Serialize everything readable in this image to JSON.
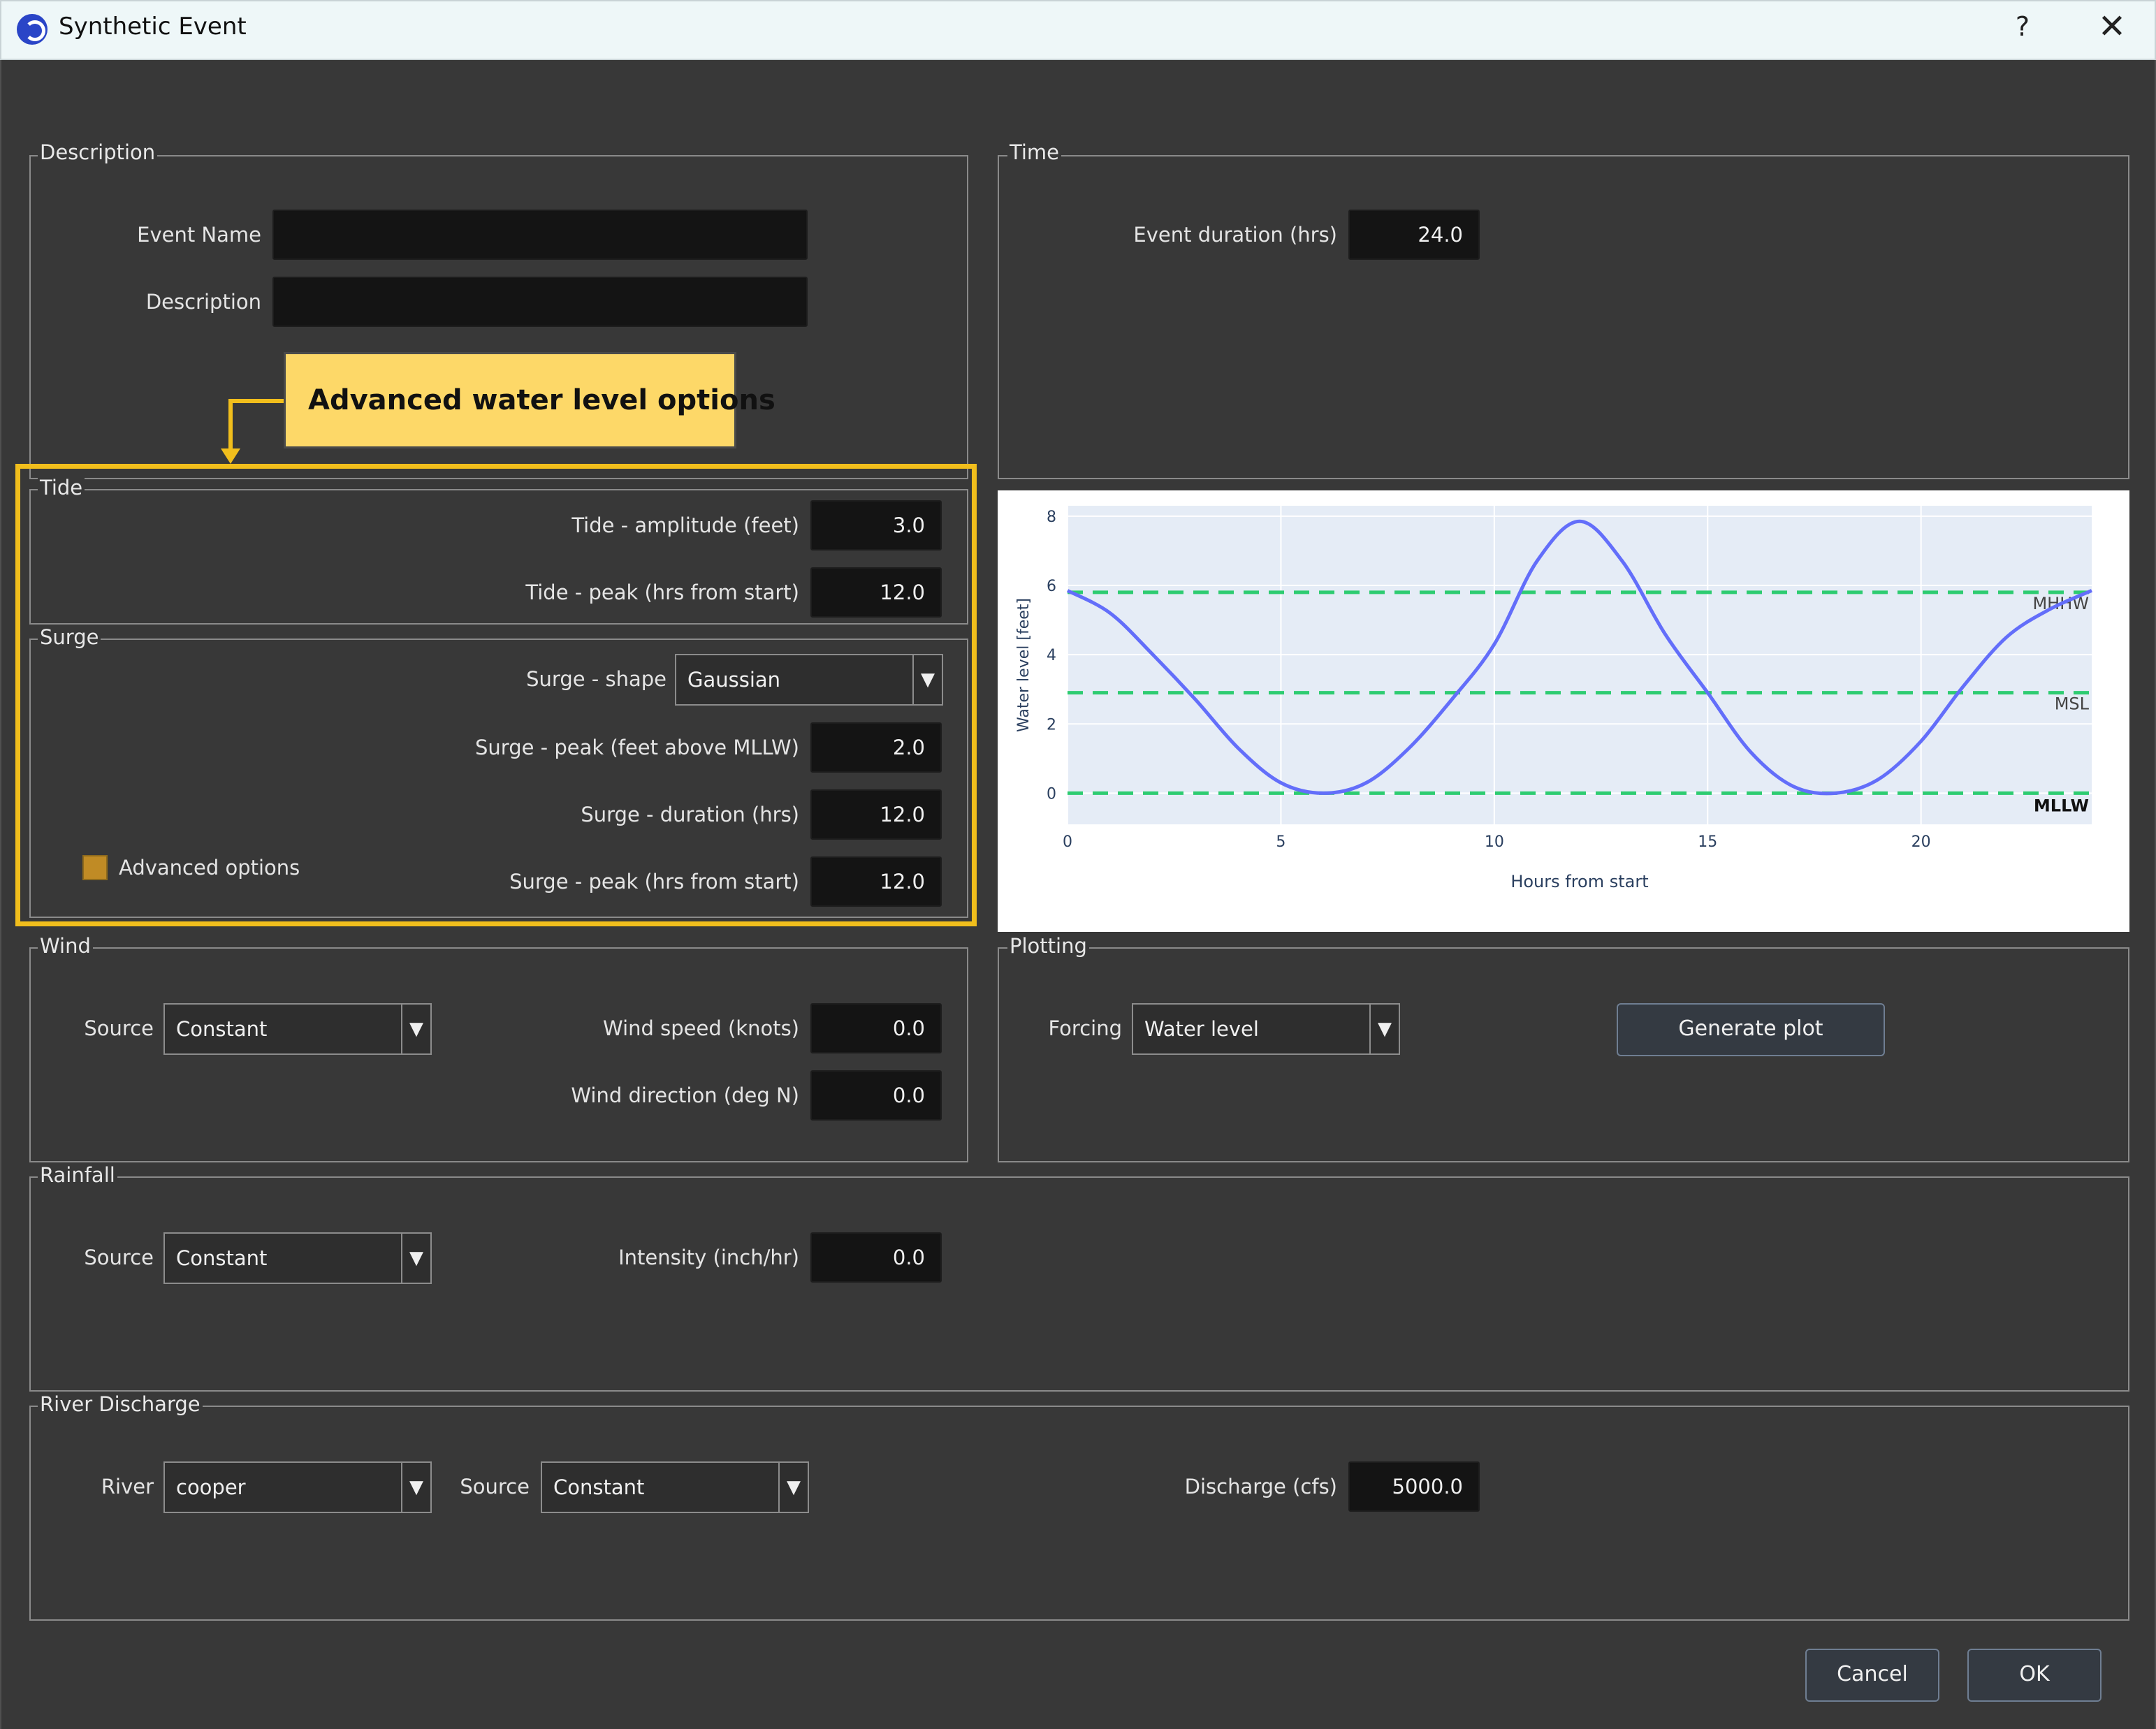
{
  "window": {
    "title": "Synthetic Event",
    "help_label": "?",
    "close_label": "✕",
    "app_icon": "app-logo-icon"
  },
  "callout": {
    "text": "Advanced water level options",
    "color": "#f1be1c"
  },
  "description_group": {
    "legend": "Description",
    "event_name_label": "Event Name",
    "event_name_value": "",
    "description_label": "Description",
    "description_value": ""
  },
  "time_group": {
    "legend": "Time",
    "duration_label": "Event duration (hrs)",
    "duration_value": "24.0"
  },
  "tide_group": {
    "legend": "Tide",
    "amplitude_label": "Tide - amplitude (feet)",
    "amplitude_value": "3.0",
    "peak_label": "Tide - peak (hrs from start)",
    "peak_value": "12.0"
  },
  "surge_group": {
    "legend": "Surge",
    "shape_label": "Surge - shape",
    "shape_value": "Gaussian",
    "peak_label": "Surge - peak (feet above MLLW)",
    "peak_value": "2.0",
    "duration_label": "Surge - duration (hrs)",
    "duration_value": "12.0",
    "peak_time_label": "Surge - peak (hrs from start)",
    "peak_time_value": "12.0",
    "advanced_label": "Advanced options",
    "advanced_checked": true
  },
  "wind_group": {
    "legend": "Wind",
    "source_label": "Source",
    "source_value": "Constant",
    "speed_label": "Wind speed (knots)",
    "speed_value": "0.0",
    "direction_label": "Wind direction (deg N)",
    "direction_value": "0.0"
  },
  "plotting_group": {
    "legend": "Plotting",
    "forcing_label": "Forcing",
    "forcing_value": "Water level",
    "generate_label": "Generate plot"
  },
  "rainfall_group": {
    "legend": "Rainfall",
    "source_label": "Source",
    "source_value": "Constant",
    "intensity_label": "Intensity (inch/hr)",
    "intensity_value": "0.0"
  },
  "river_group": {
    "legend": "River Discharge",
    "river_label": "River",
    "river_value": "cooper",
    "source_label": "Source",
    "source_value": "Constant",
    "discharge_label": "Discharge (cfs)",
    "discharge_value": "5000.0"
  },
  "buttons": {
    "cancel_label": "Cancel",
    "ok_label": "OK"
  },
  "chart_data": {
    "type": "line",
    "xlabel": "Hours from start",
    "ylabel": "Water level [feet]",
    "xlim": [
      0,
      24
    ],
    "ylim": [
      -0.9,
      8.3
    ],
    "x_ticks": [
      0,
      5,
      10,
      15,
      20
    ],
    "y_ticks": [
      0,
      2,
      4,
      6,
      8
    ],
    "grid": true,
    "series": [
      {
        "color": "#636efa",
        "x": [
          0,
          1,
          2,
          3,
          4,
          5,
          6,
          7,
          8,
          9,
          10,
          11,
          12,
          13,
          14,
          15,
          16,
          17,
          18,
          19,
          20,
          21,
          22,
          23,
          24
        ],
        "y": [
          5.85,
          5.2,
          4.0,
          2.7,
          1.3,
          0.3,
          0.0,
          0.3,
          1.3,
          2.7,
          4.3,
          6.7,
          7.85,
          6.7,
          4.6,
          2.9,
          1.2,
          0.2,
          0.0,
          0.4,
          1.5,
          3.1,
          4.5,
          5.3,
          5.85
        ]
      }
    ],
    "reference_lines": [
      {
        "label": "MHHW",
        "value": 5.8,
        "color": "#2ecc71"
      },
      {
        "label": "MSL",
        "value": 2.9,
        "color": "#2ecc71"
      },
      {
        "label": "MLLW",
        "value": 0.0,
        "color": "#2ecc71"
      }
    ]
  }
}
